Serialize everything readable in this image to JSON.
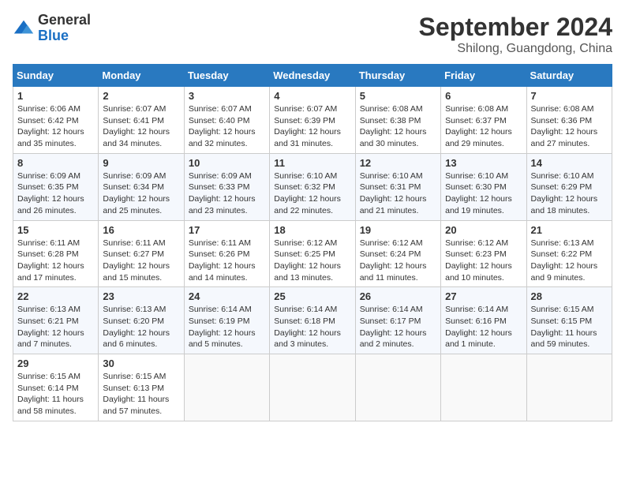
{
  "logo": {
    "general": "General",
    "blue": "Blue"
  },
  "header": {
    "month": "September 2024",
    "location": "Shilong, Guangdong, China"
  },
  "weekdays": [
    "Sunday",
    "Monday",
    "Tuesday",
    "Wednesday",
    "Thursday",
    "Friday",
    "Saturday"
  ],
  "weeks": [
    [
      {
        "day": "1",
        "sunrise": "6:06 AM",
        "sunset": "6:42 PM",
        "daylight": "12 hours and 35 minutes."
      },
      {
        "day": "2",
        "sunrise": "6:07 AM",
        "sunset": "6:41 PM",
        "daylight": "12 hours and 34 minutes."
      },
      {
        "day": "3",
        "sunrise": "6:07 AM",
        "sunset": "6:40 PM",
        "daylight": "12 hours and 32 minutes."
      },
      {
        "day": "4",
        "sunrise": "6:07 AM",
        "sunset": "6:39 PM",
        "daylight": "12 hours and 31 minutes."
      },
      {
        "day": "5",
        "sunrise": "6:08 AM",
        "sunset": "6:38 PM",
        "daylight": "12 hours and 30 minutes."
      },
      {
        "day": "6",
        "sunrise": "6:08 AM",
        "sunset": "6:37 PM",
        "daylight": "12 hours and 29 minutes."
      },
      {
        "day": "7",
        "sunrise": "6:08 AM",
        "sunset": "6:36 PM",
        "daylight": "12 hours and 27 minutes."
      }
    ],
    [
      {
        "day": "8",
        "sunrise": "6:09 AM",
        "sunset": "6:35 PM",
        "daylight": "12 hours and 26 minutes."
      },
      {
        "day": "9",
        "sunrise": "6:09 AM",
        "sunset": "6:34 PM",
        "daylight": "12 hours and 25 minutes."
      },
      {
        "day": "10",
        "sunrise": "6:09 AM",
        "sunset": "6:33 PM",
        "daylight": "12 hours and 23 minutes."
      },
      {
        "day": "11",
        "sunrise": "6:10 AM",
        "sunset": "6:32 PM",
        "daylight": "12 hours and 22 minutes."
      },
      {
        "day": "12",
        "sunrise": "6:10 AM",
        "sunset": "6:31 PM",
        "daylight": "12 hours and 21 minutes."
      },
      {
        "day": "13",
        "sunrise": "6:10 AM",
        "sunset": "6:30 PM",
        "daylight": "12 hours and 19 minutes."
      },
      {
        "day": "14",
        "sunrise": "6:10 AM",
        "sunset": "6:29 PM",
        "daylight": "12 hours and 18 minutes."
      }
    ],
    [
      {
        "day": "15",
        "sunrise": "6:11 AM",
        "sunset": "6:28 PM",
        "daylight": "12 hours and 17 minutes."
      },
      {
        "day": "16",
        "sunrise": "6:11 AM",
        "sunset": "6:27 PM",
        "daylight": "12 hours and 15 minutes."
      },
      {
        "day": "17",
        "sunrise": "6:11 AM",
        "sunset": "6:26 PM",
        "daylight": "12 hours and 14 minutes."
      },
      {
        "day": "18",
        "sunrise": "6:12 AM",
        "sunset": "6:25 PM",
        "daylight": "12 hours and 13 minutes."
      },
      {
        "day": "19",
        "sunrise": "6:12 AM",
        "sunset": "6:24 PM",
        "daylight": "12 hours and 11 minutes."
      },
      {
        "day": "20",
        "sunrise": "6:12 AM",
        "sunset": "6:23 PM",
        "daylight": "12 hours and 10 minutes."
      },
      {
        "day": "21",
        "sunrise": "6:13 AM",
        "sunset": "6:22 PM",
        "daylight": "12 hours and 9 minutes."
      }
    ],
    [
      {
        "day": "22",
        "sunrise": "6:13 AM",
        "sunset": "6:21 PM",
        "daylight": "12 hours and 7 minutes."
      },
      {
        "day": "23",
        "sunrise": "6:13 AM",
        "sunset": "6:20 PM",
        "daylight": "12 hours and 6 minutes."
      },
      {
        "day": "24",
        "sunrise": "6:14 AM",
        "sunset": "6:19 PM",
        "daylight": "12 hours and 5 minutes."
      },
      {
        "day": "25",
        "sunrise": "6:14 AM",
        "sunset": "6:18 PM",
        "daylight": "12 hours and 3 minutes."
      },
      {
        "day": "26",
        "sunrise": "6:14 AM",
        "sunset": "6:17 PM",
        "daylight": "12 hours and 2 minutes."
      },
      {
        "day": "27",
        "sunrise": "6:14 AM",
        "sunset": "6:16 PM",
        "daylight": "12 hours and 1 minute."
      },
      {
        "day": "28",
        "sunrise": "6:15 AM",
        "sunset": "6:15 PM",
        "daylight": "11 hours and 59 minutes."
      }
    ],
    [
      {
        "day": "29",
        "sunrise": "6:15 AM",
        "sunset": "6:14 PM",
        "daylight": "11 hours and 58 minutes."
      },
      {
        "day": "30",
        "sunrise": "6:15 AM",
        "sunset": "6:13 PM",
        "daylight": "11 hours and 57 minutes."
      },
      null,
      null,
      null,
      null,
      null
    ]
  ]
}
